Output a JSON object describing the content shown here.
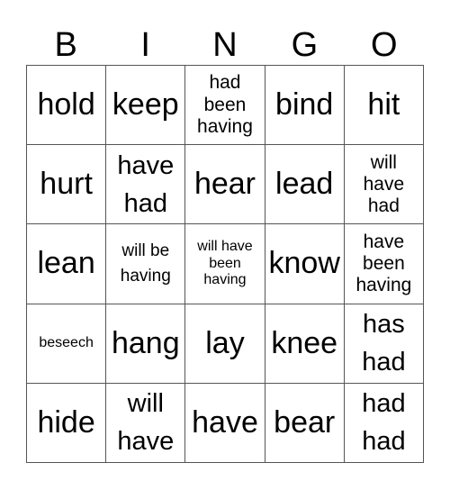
{
  "header": {
    "letters": [
      "B",
      "I",
      "N",
      "G",
      "O"
    ]
  },
  "cells": [
    [
      "hold",
      "keep",
      "had been having",
      "bind",
      "hit"
    ],
    [
      "hurt",
      "have had",
      "hear",
      "lead",
      "will have had"
    ],
    [
      "lean",
      "will be having",
      "will have been having",
      "know",
      "have been having"
    ],
    [
      "beseech",
      "hang",
      "lay",
      "knee",
      "has had"
    ],
    [
      "hide",
      "will have",
      "have",
      "bear",
      "had had"
    ]
  ]
}
